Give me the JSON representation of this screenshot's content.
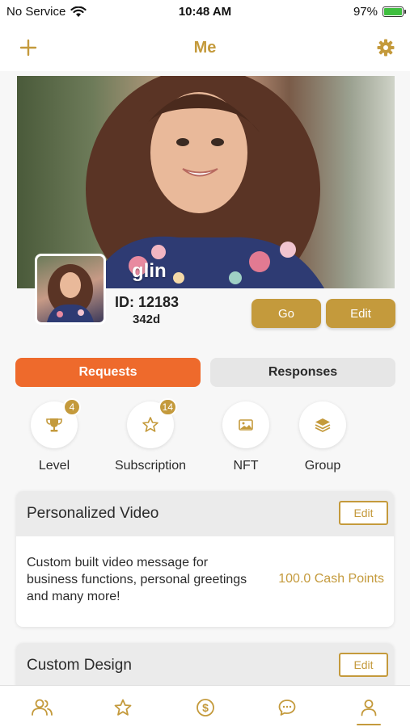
{
  "status_bar": {
    "carrier": "No Service",
    "time": "10:48 AM",
    "battery": "97%"
  },
  "nav": {
    "title": "Me",
    "left_icon": "plus-icon",
    "right_icon": "gear-icon"
  },
  "profile": {
    "username": "glin",
    "id_text": "ID: 12183",
    "days_text": "342d",
    "go_label": "Go",
    "edit_label": "Edit"
  },
  "segments": {
    "requests_label": "Requests",
    "responses_label": "Responses",
    "active": "Requests"
  },
  "categories": [
    {
      "label": "Level",
      "icon": "trophy-icon",
      "badge": "4"
    },
    {
      "label": "Subscription",
      "icon": "star-icon",
      "badge": "14"
    },
    {
      "label": "NFT",
      "icon": "image-icon",
      "badge": ""
    },
    {
      "label": "Group",
      "icon": "layers-icon",
      "badge": ""
    }
  ],
  "services": [
    {
      "title": "Personalized Video",
      "edit_label": "Edit",
      "description": "Custom built video message for business functions, personal greetings and many more!",
      "price": "100.0 Cash Points"
    },
    {
      "title": "Custom Design",
      "edit_label": "Edit"
    }
  ],
  "tab_bar": {
    "items": [
      "users-icon",
      "star-icon",
      "dollar-icon",
      "chat-icon",
      "person-icon"
    ],
    "active": "person-icon"
  },
  "colors": {
    "gold": "#c49a3c",
    "orange": "#ee6a2c",
    "battery_green": "#3fbf3f"
  }
}
